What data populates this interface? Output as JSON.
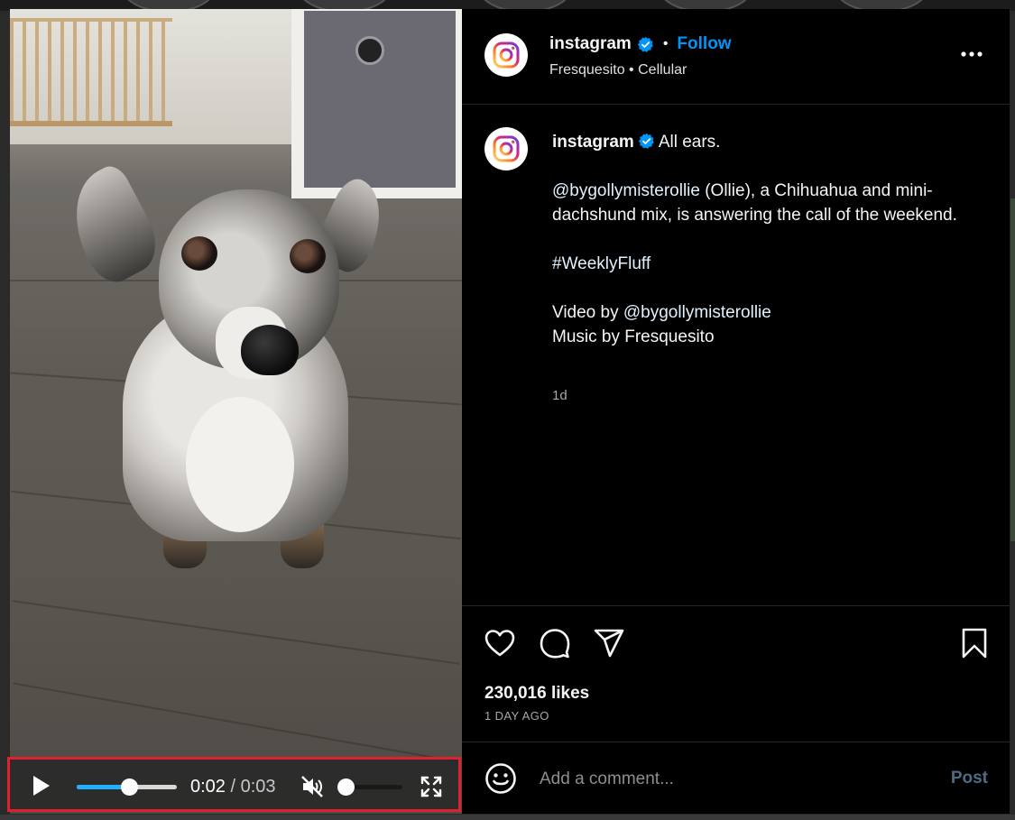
{
  "post": {
    "username": "instagram",
    "follow_label": "Follow",
    "dot": "•",
    "music": {
      "artist": "Fresquesito",
      "separator": "•",
      "track": "Cellular"
    }
  },
  "caption": {
    "username": "instagram",
    "first_line": "All ears.",
    "mention_1": "@bygollymisterollie",
    "body_1": " (Ollie), a Chihuahua and mini-dachshund mix, is answering the call of the weekend.",
    "hashtag": "#WeeklyFluff",
    "video_by_prefix": "Video by ",
    "mention_2": "@bygollymisterollie",
    "music_by": "Music by Fresquesito",
    "time_ago": "1d"
  },
  "engagement": {
    "likes": "230,016 likes",
    "date": "1 DAY AGO"
  },
  "comment": {
    "placeholder": "Add a comment...",
    "post_label": "Post"
  },
  "video": {
    "current_time": "0:02",
    "separator": " / ",
    "total_time": "0:03",
    "progress_fraction": 0.52,
    "volume_fraction": 0.0,
    "muted": true
  },
  "colors": {
    "accent": "#0095f6",
    "progress": "#22b0ff",
    "highlight_border": "#e02030",
    "background": "#000000"
  },
  "icons": {
    "header": "instagram-logo-icon",
    "verified": "verified-badge-icon",
    "more": "more-options-icon",
    "like": "heart-icon",
    "comment": "comment-bubble-icon",
    "share": "paper-plane-icon",
    "save": "bookmark-icon",
    "emoji": "emoji-smile-icon",
    "play": "play-icon",
    "mute": "muted-speaker-icon",
    "fullscreen": "fullscreen-icon"
  }
}
